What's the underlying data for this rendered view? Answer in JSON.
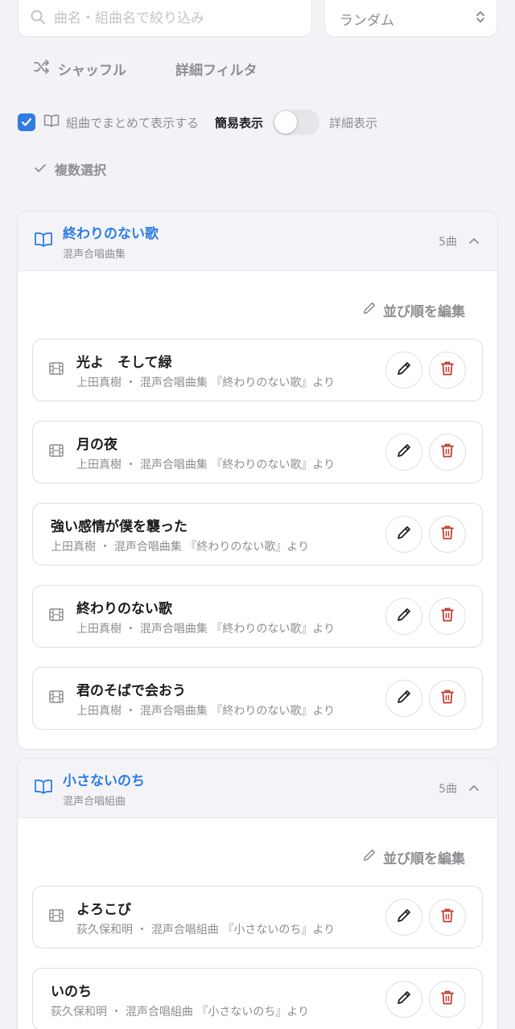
{
  "search": {
    "placeholder": "曲名・組曲名で絞り込み"
  },
  "sort": {
    "selected": "ランダム"
  },
  "toolbar": {
    "shuffle_label": "シャッフル",
    "filter_label": "詳細フィルタ"
  },
  "options": {
    "group_label": "組曲でまとめて表示する",
    "group_checked": true,
    "simple_label": "簡易表示",
    "detail_label": "詳細表示",
    "multi_select_label": "複数選択"
  },
  "colors": {
    "accent": "#2f7de1",
    "delete": "#c0392b",
    "muted": "#8e8e93"
  },
  "suites": [
    {
      "title": "終わりのない歌",
      "subtitle": "混声合唱曲集",
      "count": "5曲",
      "edit_order_label": "並び順を編集",
      "songs": [
        {
          "title": "光よ　そして緑",
          "meta": "上田真樹 ・ 混声合唱曲集 『終わりのない歌』より",
          "icon": "film-icon"
        },
        {
          "title": "月の夜",
          "meta": "上田真樹 ・ 混声合唱曲集 『終わりのない歌』より",
          "icon": "film-icon"
        },
        {
          "title": "強い感情が僕を襲った",
          "meta": "上田真樹 ・ 混声合唱曲集 『終わりのない歌』より",
          "icon": ""
        },
        {
          "title": "終わりのない歌",
          "meta": "上田真樹 ・ 混声合唱曲集 『終わりのない歌』より",
          "icon": "film-icon"
        },
        {
          "title": "君のそばで会おう",
          "meta": "上田真樹 ・ 混声合唱曲集 『終わりのない歌』より",
          "icon": "film-icon"
        }
      ]
    },
    {
      "title": "小さないのち",
      "subtitle": "混声合唱組曲",
      "count": "5曲",
      "edit_order_label": "並び順を編集",
      "songs": [
        {
          "title": "よろこび",
          "meta": "荻久保和明 ・ 混声合唱組曲 『小さないのち』より",
          "icon": "film-icon"
        },
        {
          "title": "いのち",
          "meta": "荻久保和明 ・ 混声合唱組曲 『小さないのち』より",
          "icon": ""
        }
      ]
    }
  ]
}
